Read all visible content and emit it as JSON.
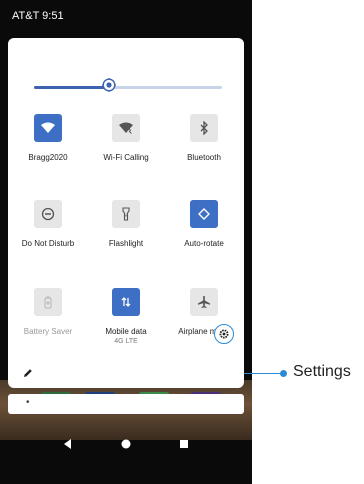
{
  "status_bar": {
    "carrier_time": "AT&T  9:51"
  },
  "brightness": {
    "level": 0.4
  },
  "tiles": [
    {
      "label": "Bragg2020",
      "sub": "",
      "state": "on",
      "icon": "wifi-icon"
    },
    {
      "label": "Wi-Fi Calling",
      "sub": "",
      "state": "off",
      "icon": "wifi-calling-icon"
    },
    {
      "label": "Bluetooth",
      "sub": "",
      "state": "off",
      "icon": "bluetooth-icon"
    },
    {
      "label": "Do Not Disturb",
      "sub": "",
      "state": "off",
      "icon": "do-not-disturb-icon"
    },
    {
      "label": "Flashlight",
      "sub": "",
      "state": "off",
      "icon": "flashlight-icon"
    },
    {
      "label": "Auto-rotate",
      "sub": "",
      "state": "on",
      "icon": "auto-rotate-icon"
    },
    {
      "label": "Battery Saver",
      "sub": "",
      "state": "disabled",
      "icon": "battery-saver-icon"
    },
    {
      "label": "Mobile data",
      "sub": "4G LTE",
      "state": "on",
      "icon": "mobile-data-icon"
    },
    {
      "label": "Airplane mode",
      "sub": "",
      "state": "off",
      "icon": "airplane-icon"
    }
  ],
  "notification": {
    "text": "•"
  },
  "callout": {
    "label": "Settings"
  },
  "colors": {
    "accent": "#3d6fc4",
    "callout": "#2a8cd8"
  }
}
